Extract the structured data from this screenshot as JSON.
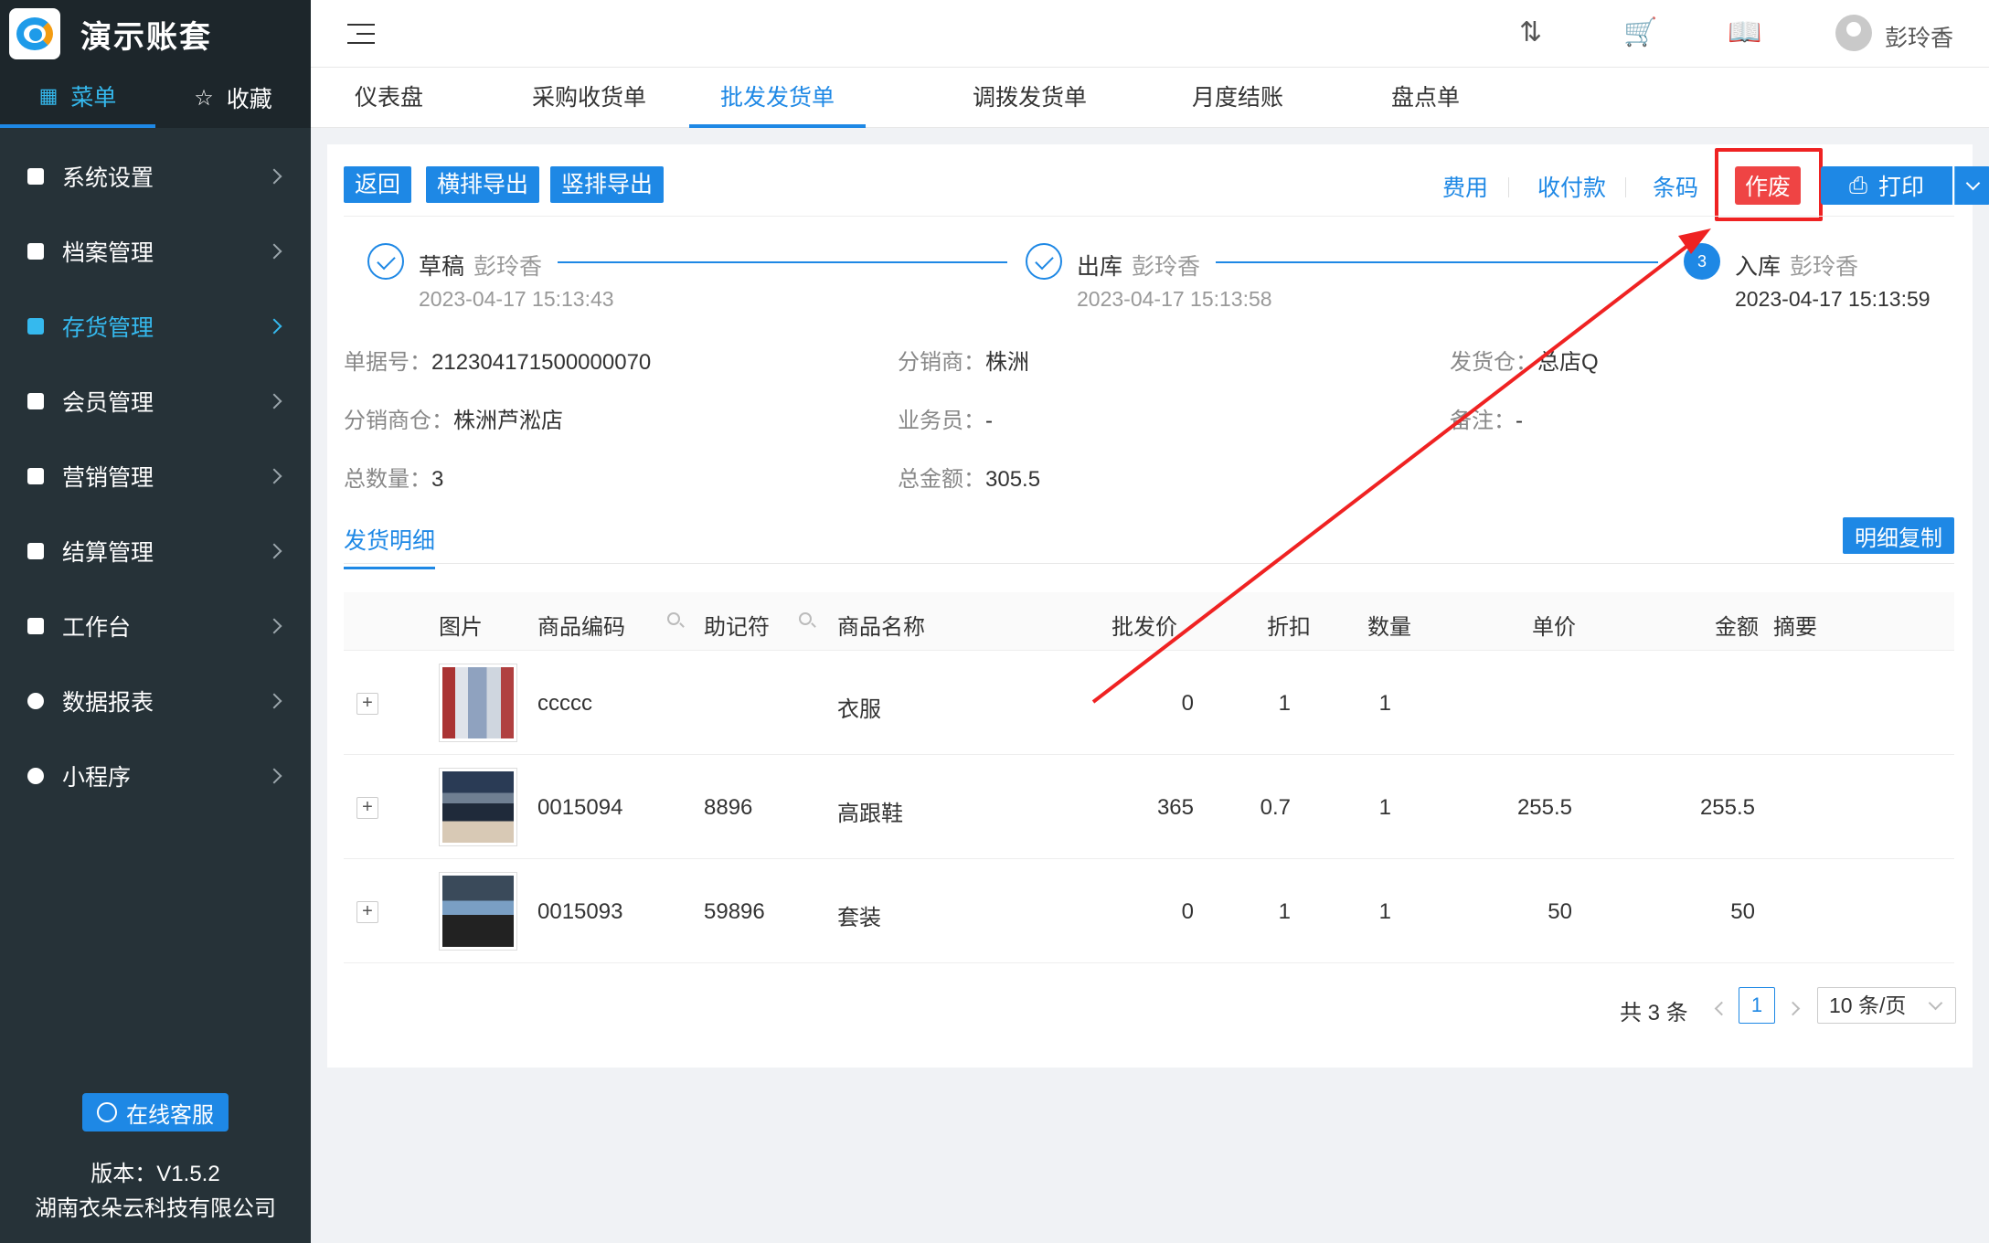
{
  "brand": {
    "title": "演示账套"
  },
  "sidebar": {
    "tabs": [
      {
        "label": "菜单",
        "icon": "grid-icon"
      },
      {
        "label": "收藏",
        "icon": "star-icon"
      }
    ],
    "items": [
      {
        "label": "系统设置"
      },
      {
        "label": "档案管理"
      },
      {
        "label": "存货管理",
        "active": true
      },
      {
        "label": "会员管理"
      },
      {
        "label": "营销管理"
      },
      {
        "label": "结算管理"
      },
      {
        "label": "工作台"
      },
      {
        "label": "数据报表"
      },
      {
        "label": "小程序"
      }
    ],
    "service": "在线客服",
    "version": "版本：V1.5.2",
    "company": "湖南衣朵云科技有限公司"
  },
  "header": {
    "user": "彭玲香",
    "icons": [
      "sort-az-icon",
      "cart-icon",
      "book-icon",
      "user-avatar-icon"
    ]
  },
  "page_tabs": [
    "仪表盘",
    "采购收货单",
    "批发发货单",
    "调拨发货单",
    "月度结账",
    "盘点单"
  ],
  "toolbar": {
    "back": "返回",
    "export_h": "横排导出",
    "export_v": "竖排导出",
    "fee": "费用",
    "payment": "收付款",
    "barcode": "条码",
    "void": "作废",
    "print": "打印"
  },
  "steps": [
    {
      "title": "草稿",
      "user": "彭玲香",
      "time": "2023-04-17 15:13:43"
    },
    {
      "title": "出库",
      "user": "彭玲香",
      "time": "2023-04-17 15:13:58"
    },
    {
      "num": "3",
      "title": "入库",
      "user": "彭玲香",
      "time": "2023-04-17 15:13:59"
    }
  ],
  "info": {
    "order_no_k": "单据号：",
    "order_no": "212304171500000070",
    "distributor_k": "分销商：",
    "distributor": "株洲",
    "warehouse_k": "发货仓：",
    "warehouse": "总店Q",
    "dist_wh_k": "分销商仓：",
    "dist_wh": "株洲芦淞店",
    "salesman_k": "业务员：",
    "salesman": "-",
    "remark_k": "备注：",
    "remark": "-",
    "total_qty_k": "总数量：",
    "total_qty": "3",
    "total_amt_k": "总金额：",
    "total_amt": "305.5"
  },
  "detail": {
    "tab": "发货明细",
    "copy": "明细复制"
  },
  "table": {
    "headers": [
      "图片",
      "商品编码",
      "助记符",
      "商品名称",
      "批发价",
      "折扣",
      "数量",
      "单价",
      "金额",
      "摘要"
    ],
    "rows": [
      {
        "code": "ccccc",
        "mnemonic": "",
        "name": "衣服",
        "price": "0",
        "discount": "1",
        "qty": "1",
        "unit": "",
        "amount": "",
        "note": ""
      },
      {
        "code": "0015094",
        "mnemonic": "8896",
        "name": "高跟鞋",
        "price": "365",
        "discount": "0.7",
        "qty": "1",
        "unit": "255.5",
        "amount": "255.5",
        "note": ""
      },
      {
        "code": "0015093",
        "mnemonic": "59896",
        "name": "套装",
        "price": "0",
        "discount": "1",
        "qty": "1",
        "unit": "50",
        "amount": "50",
        "note": ""
      }
    ]
  },
  "pagination": {
    "total": "共 3 条",
    "current": "1",
    "size": "10 条/页"
  },
  "colors": {
    "primary": "#1e88e5",
    "danger": "#ef4444",
    "sidebar": "#263238",
    "annotation": "#ef2222"
  }
}
